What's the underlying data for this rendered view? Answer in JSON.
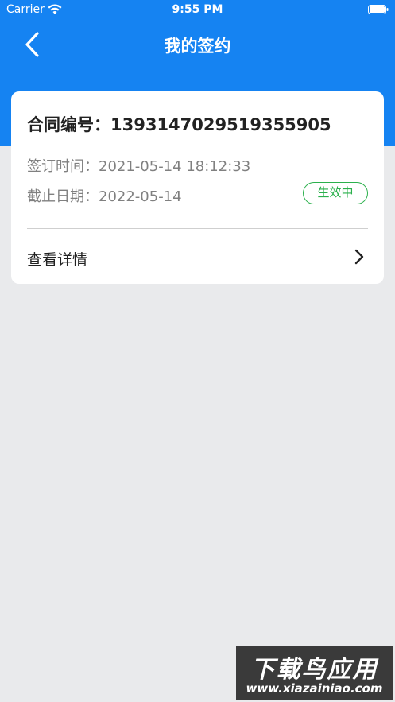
{
  "status_bar": {
    "carrier": "Carrier",
    "time": "9:55 PM"
  },
  "nav": {
    "title": "我的签约",
    "back_icon": "chevron-left-icon"
  },
  "card": {
    "contract_label": "合同编号：",
    "contract_number": "1393147029519355905",
    "sign_time_label": "签订时间：",
    "sign_time": "2021-05-14 18:12:33",
    "end_date_label": "截止日期：",
    "end_date": "2022-05-14",
    "status": "生效中",
    "view_details": "查看详情"
  },
  "colors": {
    "header": "#1583f2",
    "status_green": "#2bb04c",
    "background": "#e9eaec"
  },
  "watermark": {
    "main": "下载鸟应用",
    "url": "www.xiazainiao.com"
  }
}
